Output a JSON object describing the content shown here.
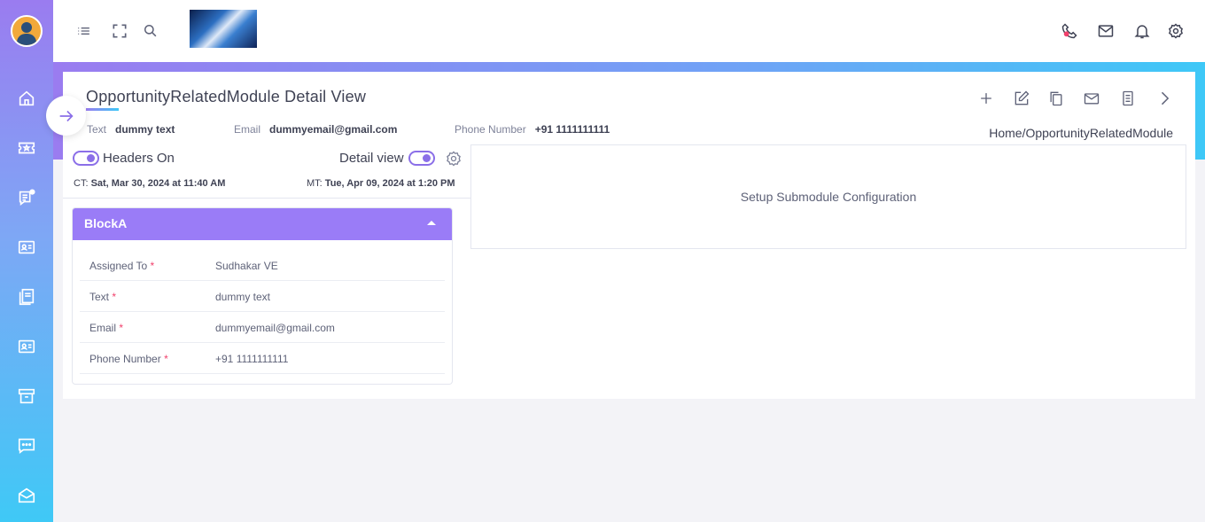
{
  "sidebar": {
    "avatar": "user-avatar",
    "items": [
      {
        "icon": "home-icon"
      },
      {
        "icon": "ticket-icon"
      },
      {
        "icon": "chat-notification-icon"
      },
      {
        "icon": "contact-card-icon"
      },
      {
        "icon": "pdf-docs-icon"
      },
      {
        "icon": "id-card-icon"
      },
      {
        "icon": "archive-icon"
      },
      {
        "icon": "message-dots-icon"
      },
      {
        "icon": "mail-open-icon"
      }
    ]
  },
  "topbar": {
    "icons": [
      "menu-list-icon",
      "fullscreen-icon",
      "search-icon"
    ],
    "right_icons": [
      "phone-icon",
      "mail-icon",
      "bell-icon",
      "settings-icon"
    ],
    "status_color": "#f1416c"
  },
  "header": {
    "title": "OpportunityRelatedModule Detail View",
    "fields": [
      {
        "label": "Text",
        "value": "dummy text"
      },
      {
        "label": "Email",
        "value": "dummyemail@gmail.com"
      },
      {
        "label": "Phone Number",
        "value": "+91 1111111111"
      }
    ],
    "breadcrumb": "Home/OpportunityRelatedModule",
    "actions": [
      "add-icon",
      "edit-icon",
      "copy-icon",
      "mail-icon",
      "document-icon",
      "next-icon"
    ]
  },
  "toggles": {
    "headers_label": "Headers On",
    "detail_label": "Detail view"
  },
  "timestamps": {
    "ct_label": "CT:",
    "ct_value": "Sat, Mar 30, 2024 at 11:40 AM",
    "mt_label": "MT:",
    "mt_value": "Tue, Apr 09, 2024 at 1:20 PM"
  },
  "block": {
    "title": "BlockA",
    "rows": [
      {
        "label": "Assigned To",
        "required": "*",
        "value": "Sudhakar VE"
      },
      {
        "label": "Text",
        "required": "*",
        "value": "dummy text"
      },
      {
        "label": "Email",
        "required": "*",
        "value": "dummyemail@gmail.com"
      },
      {
        "label": "Phone Number",
        "required": "*",
        "value": "+91   1111111111"
      }
    ]
  },
  "submodule": {
    "text": "Setup Submodule Configuration"
  },
  "colors": {
    "accent": "#8b6fe8",
    "block_header": "#9a7cf7",
    "gradient_start": "#9a7cf0",
    "gradient_end": "#3ec8f7"
  }
}
